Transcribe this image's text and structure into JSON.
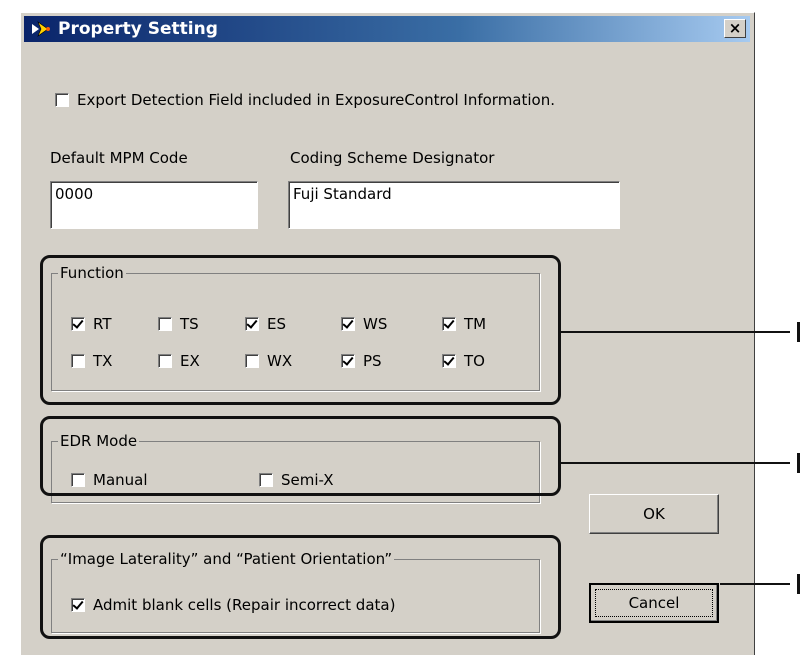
{
  "window": {
    "title": "Property Setting",
    "close_label": "×"
  },
  "export_checkbox": {
    "label": "Export Detection Field included in ExposureControl Information.",
    "checked": false
  },
  "fields": {
    "mpm": {
      "label": "Default MPM Code",
      "value": "0000"
    },
    "coding": {
      "label": "Coding Scheme Designator",
      "value": "Fuji Standard"
    }
  },
  "function": {
    "label": "Function",
    "items": [
      {
        "label": "RT",
        "checked": true
      },
      {
        "label": "TS",
        "checked": false
      },
      {
        "label": "ES",
        "checked": true
      },
      {
        "label": "WS",
        "checked": true
      },
      {
        "label": "TM",
        "checked": true
      },
      {
        "label": "TX",
        "checked": false
      },
      {
        "label": "EX",
        "checked": false
      },
      {
        "label": "WX",
        "checked": false
      },
      {
        "label": "PS",
        "checked": true
      },
      {
        "label": "TO",
        "checked": true
      }
    ]
  },
  "edr": {
    "label": "EDR Mode",
    "items": [
      {
        "label": "Manual",
        "checked": false
      },
      {
        "label": "Semi-X",
        "checked": false
      }
    ]
  },
  "laterality": {
    "label": "“Image Laterality” and “Patient Orientation”",
    "admit_label": "Admit blank cells (Repair incorrect data)",
    "admit_checked": true
  },
  "buttons": {
    "ok": "OK",
    "cancel": "Cancel"
  },
  "callouts": [
    "I",
    "I",
    "I"
  ],
  "colors": {
    "titlebar_start": "#0a246a",
    "titlebar_end": "#a6caf0",
    "dialog_bg": "#d4d0c8",
    "highlight": "#111111"
  }
}
